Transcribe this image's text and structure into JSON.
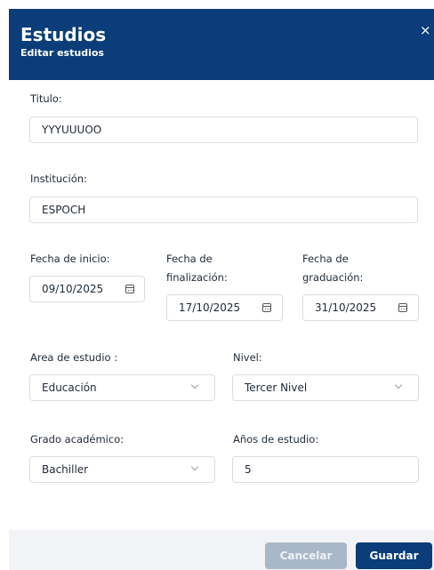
{
  "header": {
    "title": "Estudios",
    "subtitle": "Editar estudios",
    "close_icon": "×"
  },
  "form": {
    "titulo": {
      "label": "Titulo:",
      "value": "YYYUUUOO"
    },
    "institucion": {
      "label": "Institución:",
      "value": "ESPOCH"
    },
    "fecha_inicio": {
      "label": "Fecha de inicio:",
      "value": "09/10/2025"
    },
    "fecha_finalizacion": {
      "label_line1": "Fecha de",
      "label_line2": "finalización:",
      "value": "17/10/2025"
    },
    "fecha_graduacion": {
      "label_line1": "Fecha de",
      "label_line2": "graduación:",
      "value": "31/10/2025"
    },
    "area_estudio": {
      "label": "Area de estudio :",
      "value": "Educación"
    },
    "nivel": {
      "label": "Nivel:",
      "value": "Tercer Nivel"
    },
    "grado_academico": {
      "label": "Grado académico:",
      "value": "Bachiller"
    },
    "anios_estudio": {
      "label": "Años de estudio:",
      "value": "5"
    }
  },
  "footer": {
    "cancel_label": "Cancelar",
    "save_label": "Guardar"
  },
  "colors": {
    "header_bg": "#0a3d79",
    "primary_button": "#0a3d79",
    "disabled_button": "#a9b8c8",
    "footer_bg": "#f1f3f6"
  },
  "icons": {
    "date_picker": "calendar-icon",
    "select": "chevron-down-icon",
    "close": "close-icon"
  }
}
